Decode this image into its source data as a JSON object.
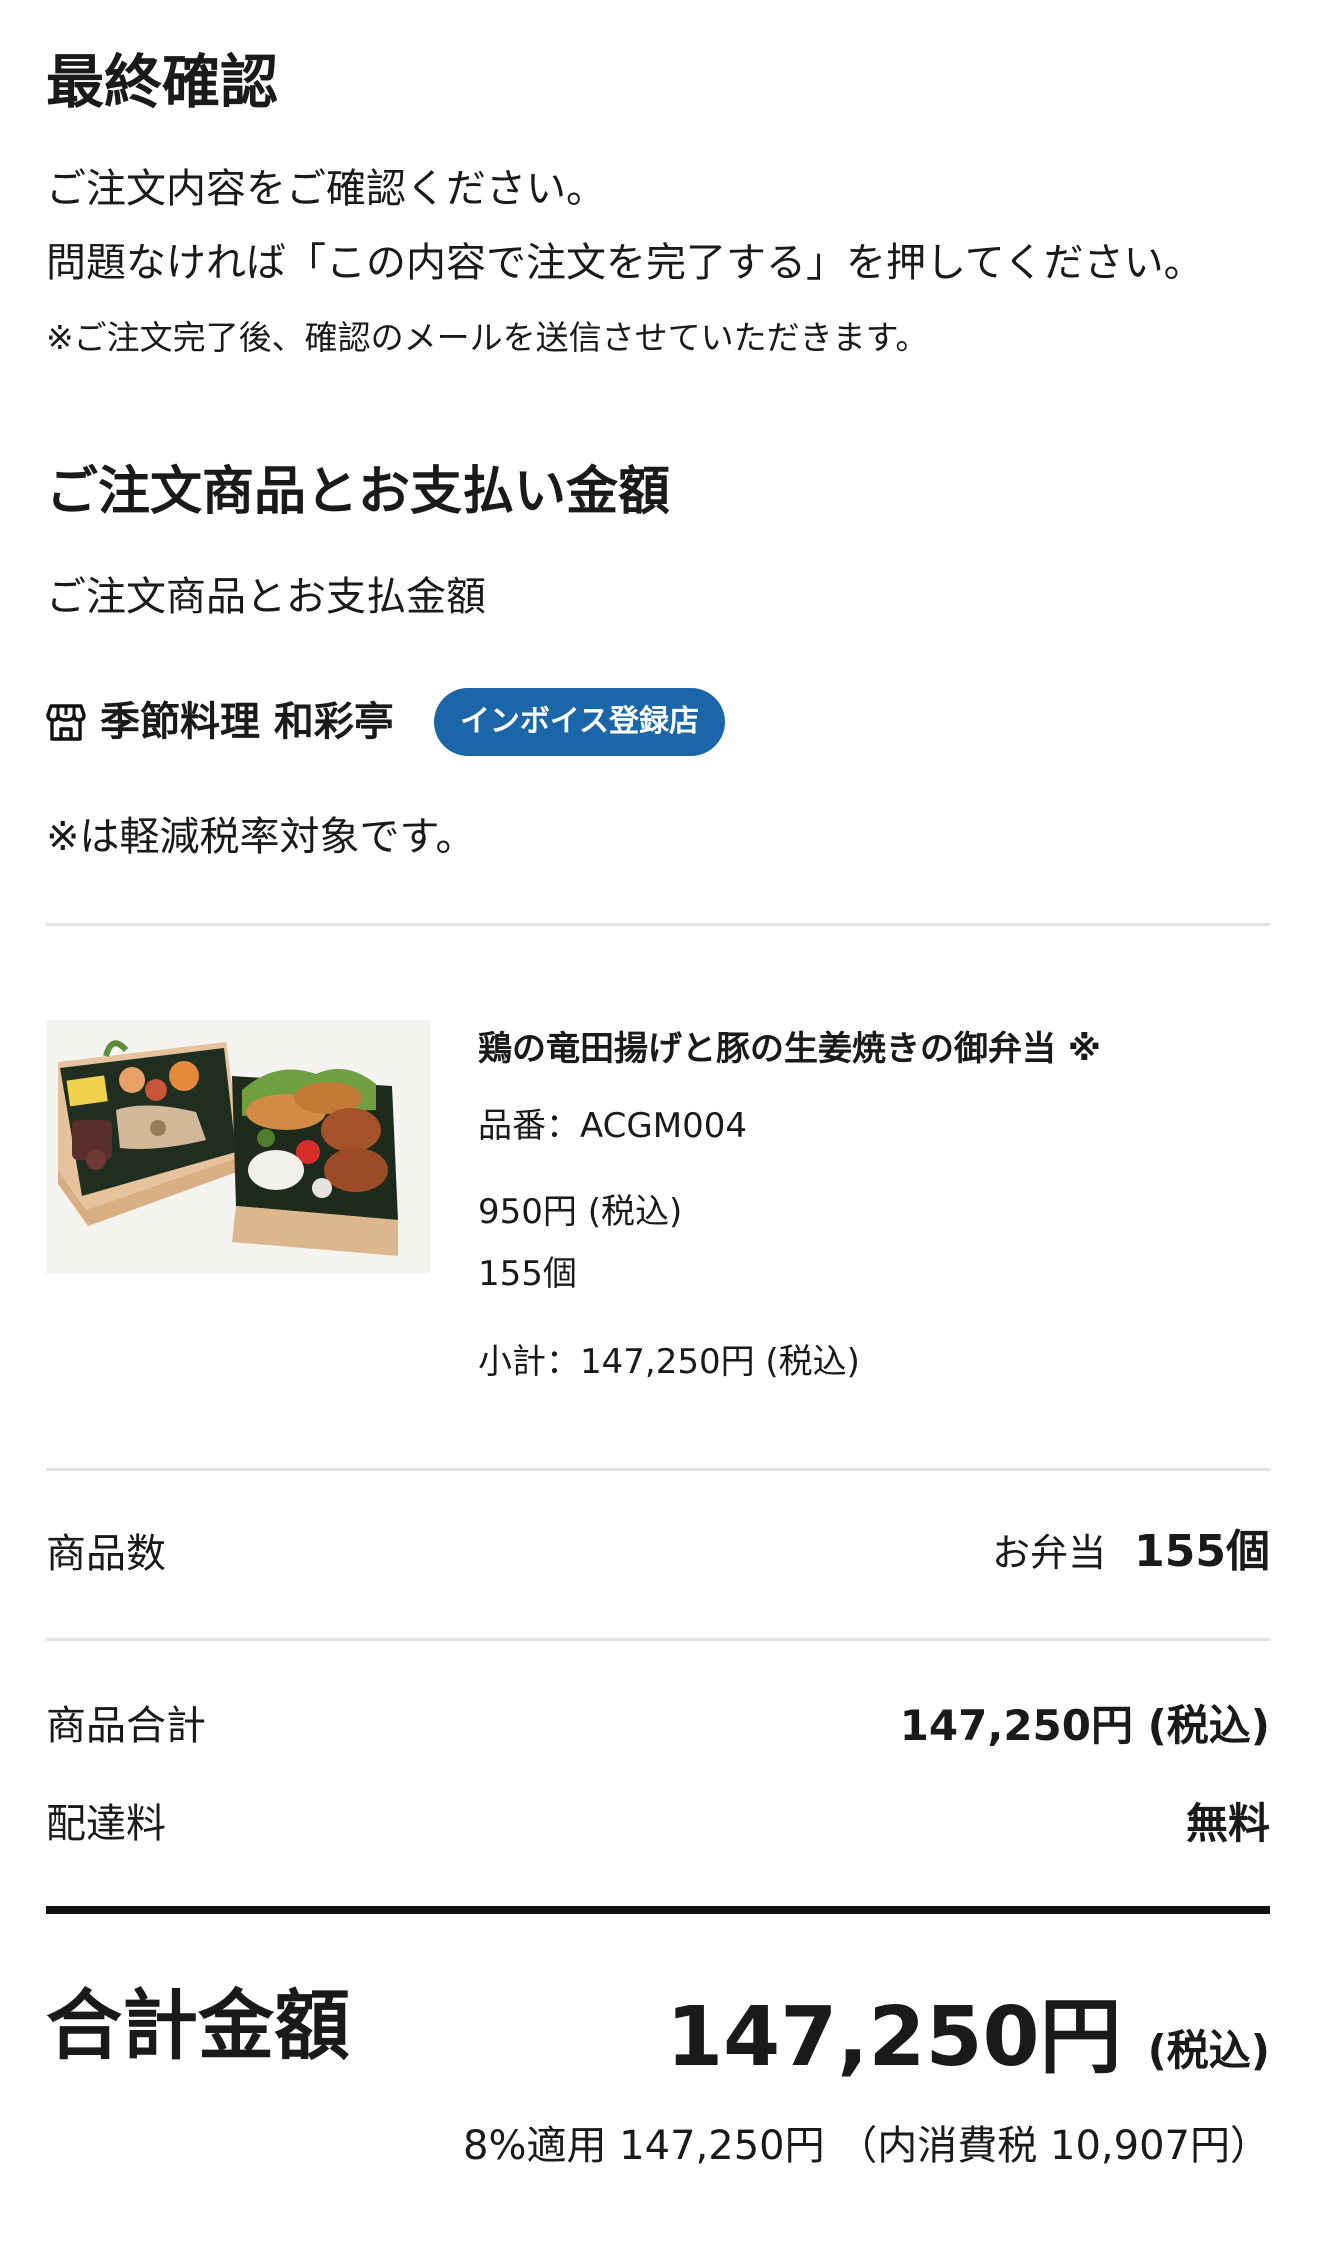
{
  "header": {
    "title": "最終確認",
    "intro_line1": "ご注文内容をご確認ください。",
    "intro_line2": "問題なければ「この内容で注文を完了する」を押してください。",
    "note": "※ご注文完了後、確認のメールを送信させていただきます。"
  },
  "order": {
    "section_title": "ご注文商品とお支払い金額",
    "subtitle": "ご注文商品とお支払金額",
    "shop": {
      "icon": "store-icon",
      "name": "季節料理 和彩亭",
      "badge": "インボイス登録店",
      "badge_color": "#1a66a8"
    },
    "tax_note": "※は軽減税率対象です。"
  },
  "item": {
    "image": "bento-photo",
    "name": "鶏の竜田揚げと豚の生姜焼きの御弁当 ※",
    "code": "品番：ACGM004",
    "price": "950円 (税込)",
    "quantity": "155個",
    "subtotal": "小計：147,250円 (税込)"
  },
  "summary": {
    "count_label": "商品数",
    "count_unit": "お弁当",
    "count_value": "155個",
    "goods_total_label": "商品合計",
    "goods_total_value": "147,250円 (税込)",
    "shipping_label": "配達料",
    "shipping_value": "無料"
  },
  "total": {
    "label": "合計金額",
    "value": "147,250円",
    "tax_label": "(税込)",
    "breakdown": "8%適用 147,250円 （内消費税 10,907円）"
  }
}
